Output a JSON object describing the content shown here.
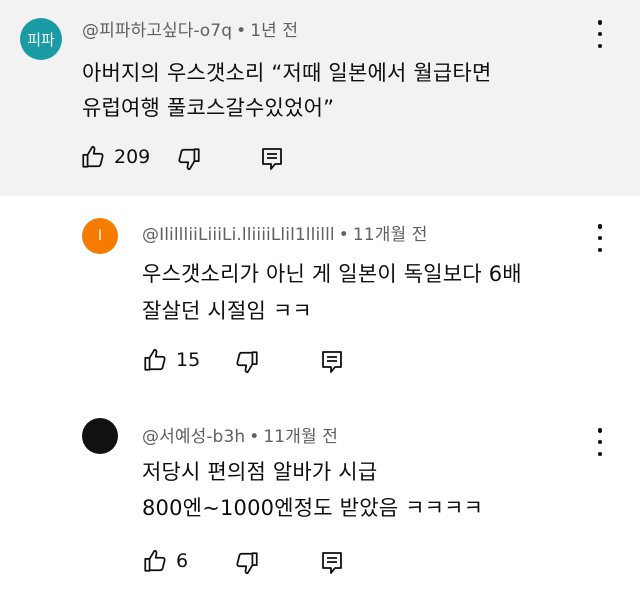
{
  "comments": [
    {
      "avatar_text": "피파",
      "avatar_color": "#1a9ba4",
      "author": "@피파하고싶다-o7q",
      "time": "1년 전",
      "lines": [
        "아버지의 우스갯소리 “저때 일본에서 월급타면",
        "유럽여행 풀코스갈수있었어”"
      ],
      "likes": "209"
    },
    {
      "avatar_text": "I",
      "avatar_color": "#f57c00",
      "author": "@IlillliiLiiiLi.lliiiiLlil1llilll",
      "time": "11개월 전",
      "lines": [
        "우스갯소리가 아닌 게 일본이 독일보다 6배",
        "잘살던 시절임 ㅋㅋ"
      ],
      "likes": "15"
    },
    {
      "avatar_text": "",
      "avatar_color": "#111111",
      "author": "@서예성-b3h",
      "time": "11개월 전",
      "lines": [
        "저당시 편의점 알바가 시급",
        "800엔~1000엔정도 받았음 ㅋㅋㅋㅋ"
      ],
      "likes": "6"
    }
  ],
  "separator": "•"
}
